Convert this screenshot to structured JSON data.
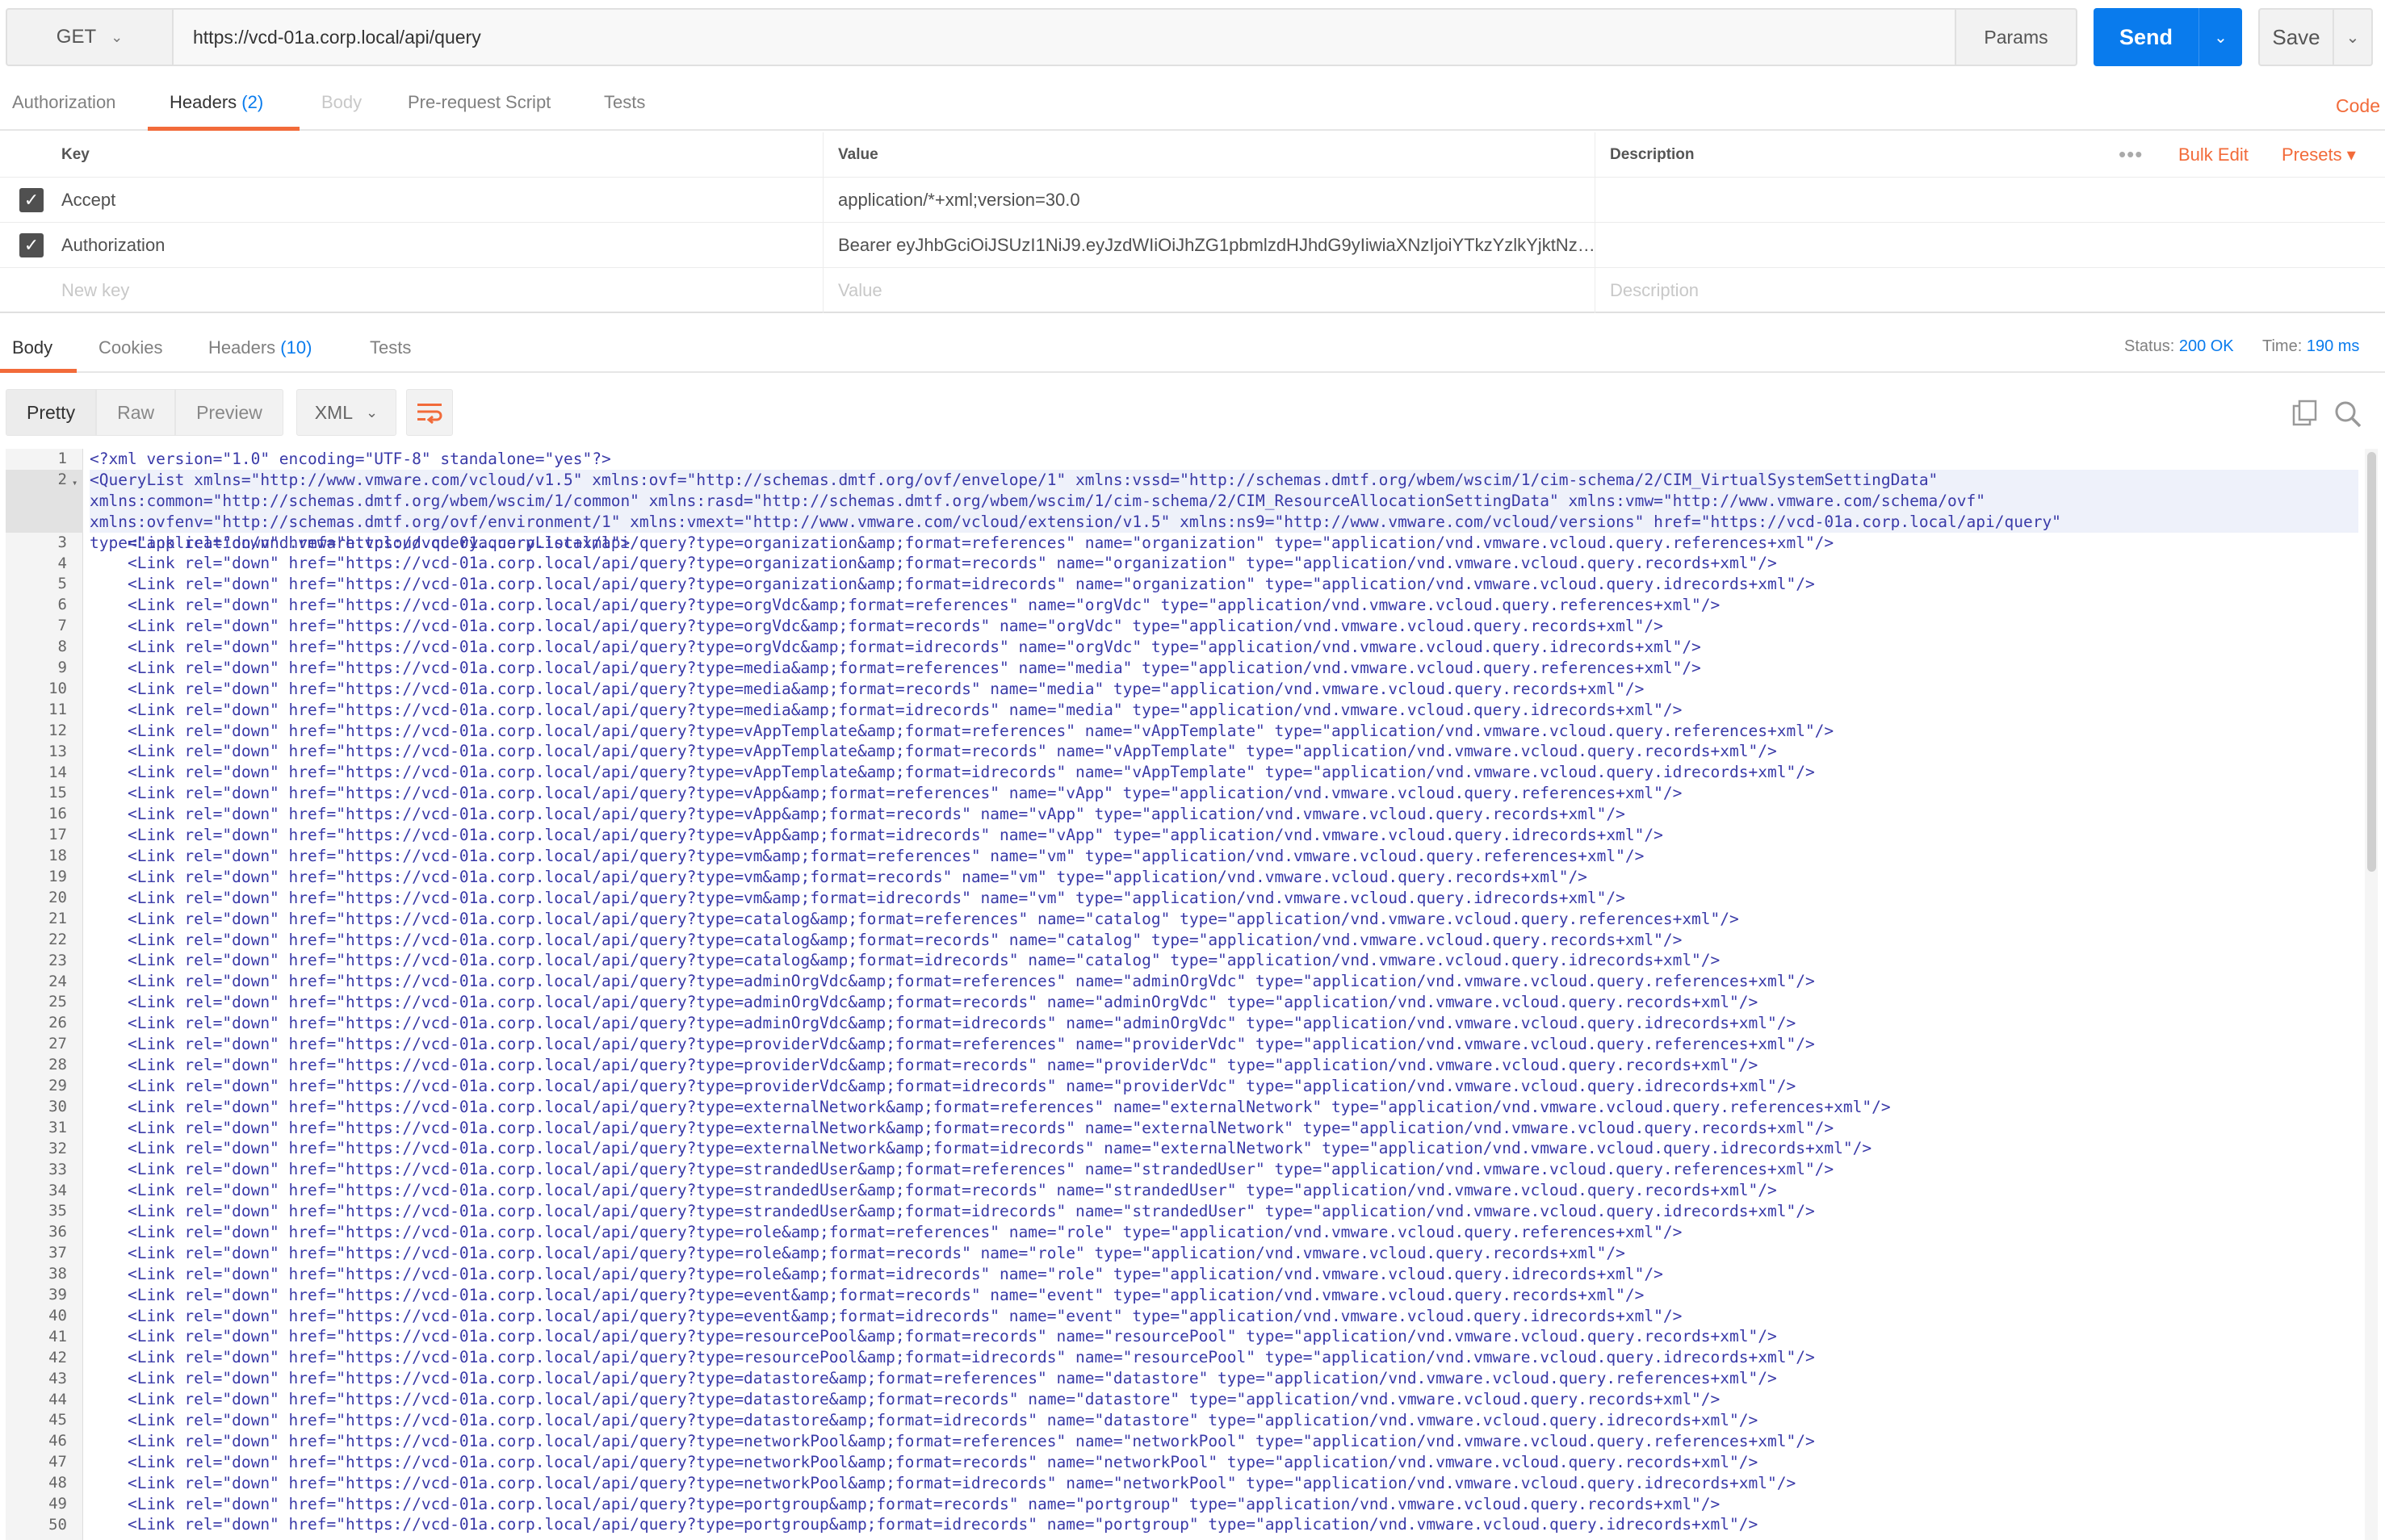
{
  "request": {
    "method": "GET",
    "url": "https://vcd-01a.corp.local/api/query",
    "params_label": "Params",
    "send_label": "Send",
    "save_label": "Save"
  },
  "request_tabs": {
    "authorization": "Authorization",
    "headers": "Headers",
    "headers_count": "(2)",
    "body": "Body",
    "prerequest": "Pre-request Script",
    "tests": "Tests",
    "code": "Code"
  },
  "headers_table": {
    "columns": {
      "key": "Key",
      "value": "Value",
      "description": "Description"
    },
    "more": "•••",
    "bulk_edit": "Bulk Edit",
    "presets": "Presets ▾",
    "rows": [
      {
        "key": "Accept",
        "value": "application/*+xml;version=30.0"
      },
      {
        "key": "Authorization",
        "value": "Bearer eyJhbGciOiJSUzI1NiJ9.eyJzdWIiOiJhZG1pbmlzdHJhdG9yIiwiaXNzIjoiYTkzYzlkYjktNz…"
      }
    ],
    "new_row": {
      "key": "New key",
      "value": "Value",
      "description": "Description"
    }
  },
  "response_tabs": {
    "body": "Body",
    "cookies": "Cookies",
    "headers": "Headers",
    "headers_count": "(10)",
    "tests": "Tests",
    "status_label": "Status:",
    "status_value": "200 OK",
    "time_label": "Time:",
    "time_value": "190 ms"
  },
  "response_toolbar": {
    "pretty": "Pretty",
    "raw": "Raw",
    "preview": "Preview",
    "format": "XML"
  },
  "code_lines": [
    "<?xml version=\"1.0\" encoding=\"UTF-8\" standalone=\"yes\"?>",
    "<QueryList xmlns=\"http://www.vmware.com/vcloud/v1.5\" xmlns:ovf=\"http://schemas.dmtf.org/ovf/envelope/1\" xmlns:vssd=\"http://schemas.dmtf.org/wbem/wscim/1/cim-schema/2/CIM_VirtualSystemSettingData\" xmlns:common=\"http://schemas.dmtf.org/wbem/wscim/1/common\" xmlns:rasd=\"http://schemas.dmtf.org/wbem/wscim/1/cim-schema/2/CIM_ResourceAllocationSettingData\" xmlns:vmw=\"http://www.vmware.com/schema/ovf\" xmlns:ovfenv=\"http://schemas.dmtf.org/ovf/environment/1\" xmlns:vmext=\"http://www.vmware.com/vcloud/extension/v1.5\" xmlns:ns9=\"http://www.vmware.com/vcloud/versions\" href=\"https://vcd-01a.corp.local/api/query\" type=\"application/vnd.vmware.vcloud.query.queryList+xml\">",
    "    <Link rel=\"down\" href=\"https://vcd-01a.corp.local/api/query?type=organization&amp;format=references\" name=\"organization\" type=\"application/vnd.vmware.vcloud.query.references+xml\"/>",
    "    <Link rel=\"down\" href=\"https://vcd-01a.corp.local/api/query?type=organization&amp;format=records\" name=\"organization\" type=\"application/vnd.vmware.vcloud.query.records+xml\"/>",
    "    <Link rel=\"down\" href=\"https://vcd-01a.corp.local/api/query?type=organization&amp;format=idrecords\" name=\"organization\" type=\"application/vnd.vmware.vcloud.query.idrecords+xml\"/>",
    "    <Link rel=\"down\" href=\"https://vcd-01a.corp.local/api/query?type=orgVdc&amp;format=references\" name=\"orgVdc\" type=\"application/vnd.vmware.vcloud.query.references+xml\"/>",
    "    <Link rel=\"down\" href=\"https://vcd-01a.corp.local/api/query?type=orgVdc&amp;format=records\" name=\"orgVdc\" type=\"application/vnd.vmware.vcloud.query.records+xml\"/>",
    "    <Link rel=\"down\" href=\"https://vcd-01a.corp.local/api/query?type=orgVdc&amp;format=idrecords\" name=\"orgVdc\" type=\"application/vnd.vmware.vcloud.query.idrecords+xml\"/>",
    "    <Link rel=\"down\" href=\"https://vcd-01a.corp.local/api/query?type=media&amp;format=references\" name=\"media\" type=\"application/vnd.vmware.vcloud.query.references+xml\"/>",
    "    <Link rel=\"down\" href=\"https://vcd-01a.corp.local/api/query?type=media&amp;format=records\" name=\"media\" type=\"application/vnd.vmware.vcloud.query.records+xml\"/>",
    "    <Link rel=\"down\" href=\"https://vcd-01a.corp.local/api/query?type=media&amp;format=idrecords\" name=\"media\" type=\"application/vnd.vmware.vcloud.query.idrecords+xml\"/>",
    "    <Link rel=\"down\" href=\"https://vcd-01a.corp.local/api/query?type=vAppTemplate&amp;format=references\" name=\"vAppTemplate\" type=\"application/vnd.vmware.vcloud.query.references+xml\"/>",
    "    <Link rel=\"down\" href=\"https://vcd-01a.corp.local/api/query?type=vAppTemplate&amp;format=records\" name=\"vAppTemplate\" type=\"application/vnd.vmware.vcloud.query.records+xml\"/>",
    "    <Link rel=\"down\" href=\"https://vcd-01a.corp.local/api/query?type=vAppTemplate&amp;format=idrecords\" name=\"vAppTemplate\" type=\"application/vnd.vmware.vcloud.query.idrecords+xml\"/>",
    "    <Link rel=\"down\" href=\"https://vcd-01a.corp.local/api/query?type=vApp&amp;format=references\" name=\"vApp\" type=\"application/vnd.vmware.vcloud.query.references+xml\"/>",
    "    <Link rel=\"down\" href=\"https://vcd-01a.corp.local/api/query?type=vApp&amp;format=records\" name=\"vApp\" type=\"application/vnd.vmware.vcloud.query.records+xml\"/>",
    "    <Link rel=\"down\" href=\"https://vcd-01a.corp.local/api/query?type=vApp&amp;format=idrecords\" name=\"vApp\" type=\"application/vnd.vmware.vcloud.query.idrecords+xml\"/>",
    "    <Link rel=\"down\" href=\"https://vcd-01a.corp.local/api/query?type=vm&amp;format=references\" name=\"vm\" type=\"application/vnd.vmware.vcloud.query.references+xml\"/>",
    "    <Link rel=\"down\" href=\"https://vcd-01a.corp.local/api/query?type=vm&amp;format=records\" name=\"vm\" type=\"application/vnd.vmware.vcloud.query.records+xml\"/>",
    "    <Link rel=\"down\" href=\"https://vcd-01a.corp.local/api/query?type=vm&amp;format=idrecords\" name=\"vm\" type=\"application/vnd.vmware.vcloud.query.idrecords+xml\"/>",
    "    <Link rel=\"down\" href=\"https://vcd-01a.corp.local/api/query?type=catalog&amp;format=references\" name=\"catalog\" type=\"application/vnd.vmware.vcloud.query.references+xml\"/>",
    "    <Link rel=\"down\" href=\"https://vcd-01a.corp.local/api/query?type=catalog&amp;format=records\" name=\"catalog\" type=\"application/vnd.vmware.vcloud.query.records+xml\"/>",
    "    <Link rel=\"down\" href=\"https://vcd-01a.corp.local/api/query?type=catalog&amp;format=idrecords\" name=\"catalog\" type=\"application/vnd.vmware.vcloud.query.idrecords+xml\"/>",
    "    <Link rel=\"down\" href=\"https://vcd-01a.corp.local/api/query?type=adminOrgVdc&amp;format=references\" name=\"adminOrgVdc\" type=\"application/vnd.vmware.vcloud.query.references+xml\"/>",
    "    <Link rel=\"down\" href=\"https://vcd-01a.corp.local/api/query?type=adminOrgVdc&amp;format=records\" name=\"adminOrgVdc\" type=\"application/vnd.vmware.vcloud.query.records+xml\"/>",
    "    <Link rel=\"down\" href=\"https://vcd-01a.corp.local/api/query?type=adminOrgVdc&amp;format=idrecords\" name=\"adminOrgVdc\" type=\"application/vnd.vmware.vcloud.query.idrecords+xml\"/>",
    "    <Link rel=\"down\" href=\"https://vcd-01a.corp.local/api/query?type=providerVdc&amp;format=references\" name=\"providerVdc\" type=\"application/vnd.vmware.vcloud.query.references+xml\"/>",
    "    <Link rel=\"down\" href=\"https://vcd-01a.corp.local/api/query?type=providerVdc&amp;format=records\" name=\"providerVdc\" type=\"application/vnd.vmware.vcloud.query.records+xml\"/>",
    "    <Link rel=\"down\" href=\"https://vcd-01a.corp.local/api/query?type=providerVdc&amp;format=idrecords\" name=\"providerVdc\" type=\"application/vnd.vmware.vcloud.query.idrecords+xml\"/>",
    "    <Link rel=\"down\" href=\"https://vcd-01a.corp.local/api/query?type=externalNetwork&amp;format=references\" name=\"externalNetwork\" type=\"application/vnd.vmware.vcloud.query.references+xml\"/>",
    "    <Link rel=\"down\" href=\"https://vcd-01a.corp.local/api/query?type=externalNetwork&amp;format=records\" name=\"externalNetwork\" type=\"application/vnd.vmware.vcloud.query.records+xml\"/>",
    "    <Link rel=\"down\" href=\"https://vcd-01a.corp.local/api/query?type=externalNetwork&amp;format=idrecords\" name=\"externalNetwork\" type=\"application/vnd.vmware.vcloud.query.idrecords+xml\"/>",
    "    <Link rel=\"down\" href=\"https://vcd-01a.corp.local/api/query?type=strandedUser&amp;format=references\" name=\"strandedUser\" type=\"application/vnd.vmware.vcloud.query.references+xml\"/>",
    "    <Link rel=\"down\" href=\"https://vcd-01a.corp.local/api/query?type=strandedUser&amp;format=records\" name=\"strandedUser\" type=\"application/vnd.vmware.vcloud.query.records+xml\"/>",
    "    <Link rel=\"down\" href=\"https://vcd-01a.corp.local/api/query?type=strandedUser&amp;format=idrecords\" name=\"strandedUser\" type=\"application/vnd.vmware.vcloud.query.idrecords+xml\"/>",
    "    <Link rel=\"down\" href=\"https://vcd-01a.corp.local/api/query?type=role&amp;format=references\" name=\"role\" type=\"application/vnd.vmware.vcloud.query.references+xml\"/>",
    "    <Link rel=\"down\" href=\"https://vcd-01a.corp.local/api/query?type=role&amp;format=records\" name=\"role\" type=\"application/vnd.vmware.vcloud.query.records+xml\"/>",
    "    <Link rel=\"down\" href=\"https://vcd-01a.corp.local/api/query?type=role&amp;format=idrecords\" name=\"role\" type=\"application/vnd.vmware.vcloud.query.idrecords+xml\"/>",
    "    <Link rel=\"down\" href=\"https://vcd-01a.corp.local/api/query?type=event&amp;format=records\" name=\"event\" type=\"application/vnd.vmware.vcloud.query.records+xml\"/>",
    "    <Link rel=\"down\" href=\"https://vcd-01a.corp.local/api/query?type=event&amp;format=idrecords\" name=\"event\" type=\"application/vnd.vmware.vcloud.query.idrecords+xml\"/>",
    "    <Link rel=\"down\" href=\"https://vcd-01a.corp.local/api/query?type=resourcePool&amp;format=records\" name=\"resourcePool\" type=\"application/vnd.vmware.vcloud.query.records+xml\"/>",
    "    <Link rel=\"down\" href=\"https://vcd-01a.corp.local/api/query?type=resourcePool&amp;format=idrecords\" name=\"resourcePool\" type=\"application/vnd.vmware.vcloud.query.idrecords+xml\"/>",
    "    <Link rel=\"down\" href=\"https://vcd-01a.corp.local/api/query?type=datastore&amp;format=references\" name=\"datastore\" type=\"application/vnd.vmware.vcloud.query.references+xml\"/>",
    "    <Link rel=\"down\" href=\"https://vcd-01a.corp.local/api/query?type=datastore&amp;format=records\" name=\"datastore\" type=\"application/vnd.vmware.vcloud.query.records+xml\"/>",
    "    <Link rel=\"down\" href=\"https://vcd-01a.corp.local/api/query?type=datastore&amp;format=idrecords\" name=\"datastore\" type=\"application/vnd.vmware.vcloud.query.idrecords+xml\"/>",
    "    <Link rel=\"down\" href=\"https://vcd-01a.corp.local/api/query?type=networkPool&amp;format=references\" name=\"networkPool\" type=\"application/vnd.vmware.vcloud.query.references+xml\"/>",
    "    <Link rel=\"down\" href=\"https://vcd-01a.corp.local/api/query?type=networkPool&amp;format=records\" name=\"networkPool\" type=\"application/vnd.vmware.vcloud.query.records+xml\"/>",
    "    <Link rel=\"down\" href=\"https://vcd-01a.corp.local/api/query?type=networkPool&amp;format=idrecords\" name=\"networkPool\" type=\"application/vnd.vmware.vcloud.query.idrecords+xml\"/>",
    "    <Link rel=\"down\" href=\"https://vcd-01a.corp.local/api/query?type=portgroup&amp;format=records\" name=\"portgroup\" type=\"application/vnd.vmware.vcloud.query.records+xml\"/>",
    "    <Link rel=\"down\" href=\"https://vcd-01a.corp.local/api/query?type=portgroup&amp;format=idrecords\" name=\"portgroup\" type=\"application/vnd.vmware.vcloud.query.idrecords+xml\"/>"
  ],
  "line_numbers": [
    "1",
    "2",
    "3",
    "4",
    "5",
    "6",
    "7",
    "8",
    "9",
    "10",
    "11",
    "12",
    "13",
    "14",
    "15",
    "16",
    "17",
    "18",
    "19",
    "20",
    "21",
    "22",
    "23",
    "24",
    "25",
    "26",
    "27",
    "28",
    "29",
    "30",
    "31",
    "32",
    "33",
    "34",
    "35",
    "36",
    "37",
    "38",
    "39",
    "40",
    "41",
    "42",
    "43",
    "44",
    "45",
    "46",
    "47",
    "48",
    "49",
    "50"
  ],
  "colors": {
    "accent": "#f26b3a",
    "send": "#097bed",
    "xml": "#3a3aa8"
  }
}
